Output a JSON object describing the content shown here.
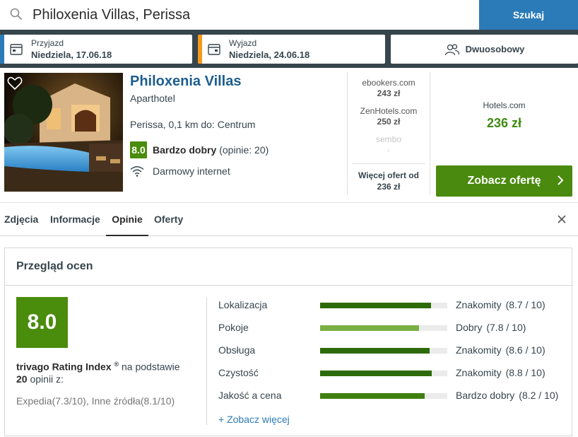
{
  "search": {
    "value": "Philoxenia Villas, Perissa",
    "button_label": "Szukaj"
  },
  "dates": {
    "checkin_label": "Przyjazd",
    "checkin_value": "Niedziela, 17.06.18",
    "checkout_label": "Wyjazd",
    "checkout_value": "Niedziela, 24.06.18",
    "room_label": "Dwuosobowy",
    "checkin_accent": "#2b7bb9",
    "checkout_accent": "#f39a1c"
  },
  "hotel": {
    "name": "Philoxenia Villas",
    "type": "Aparthotel",
    "location": "Perissa, 0,1 km do: Centrum",
    "rating_score": "8.0",
    "rating_label": "Bardzo dobry",
    "rating_count": "(opinie: 20)",
    "amenity": "Darmowy internet"
  },
  "offers": [
    {
      "site": "ebookers.com",
      "price": "243 zł",
      "dim": false
    },
    {
      "site": "ZenHotels.com",
      "price": "250 zł",
      "dim": false
    },
    {
      "site": "sembo",
      "price": "-",
      "dim": true
    }
  ],
  "more_offers": {
    "line1": "Więcej ofert od",
    "line2": "236 zł"
  },
  "best_deal": {
    "site": "Hotels.com",
    "price": "236 zł",
    "button_label": "Zobacz ofertę"
  },
  "tabs": [
    {
      "label": "Zdjęcia",
      "active": false
    },
    {
      "label": "Informacje",
      "active": false
    },
    {
      "label": "Opinie",
      "active": true
    },
    {
      "label": "Oferty",
      "active": false
    }
  ],
  "overview": {
    "title": "Przegląd ocen",
    "score": "8.0",
    "index_name": "trivago Rating Index",
    "index_mark": "®",
    "index_suffix": "na podstawie",
    "review_count": "20",
    "review_count_suffix": "opinii z:",
    "sources": "Expedia(7.3/10), Inne źródła(8.1/10)",
    "see_more": "+ Zobacz więcej",
    "categories": [
      {
        "name": "Lokalizacja",
        "verdict": "Znakomity",
        "score": "(8.7 / 10)",
        "fill": 0.87,
        "color": "#2d6b0a"
      },
      {
        "name": "Pokoje",
        "verdict": "Dobry",
        "score": "(7.8 / 10)",
        "fill": 0.78,
        "color": "#78b043"
      },
      {
        "name": "Obsługa",
        "verdict": "Znakomity",
        "score": "(8.6 / 10)",
        "fill": 0.86,
        "color": "#2d6b0a"
      },
      {
        "name": "Czystość",
        "verdict": "Znakomity",
        "score": "(8.8 / 10)",
        "fill": 0.88,
        "color": "#2d6b0a"
      },
      {
        "name": "Jakość a cena",
        "verdict": "Bardzo dobry",
        "score": "(8.2 / 10)",
        "fill": 0.82,
        "color": "#3f7f10"
      }
    ]
  }
}
